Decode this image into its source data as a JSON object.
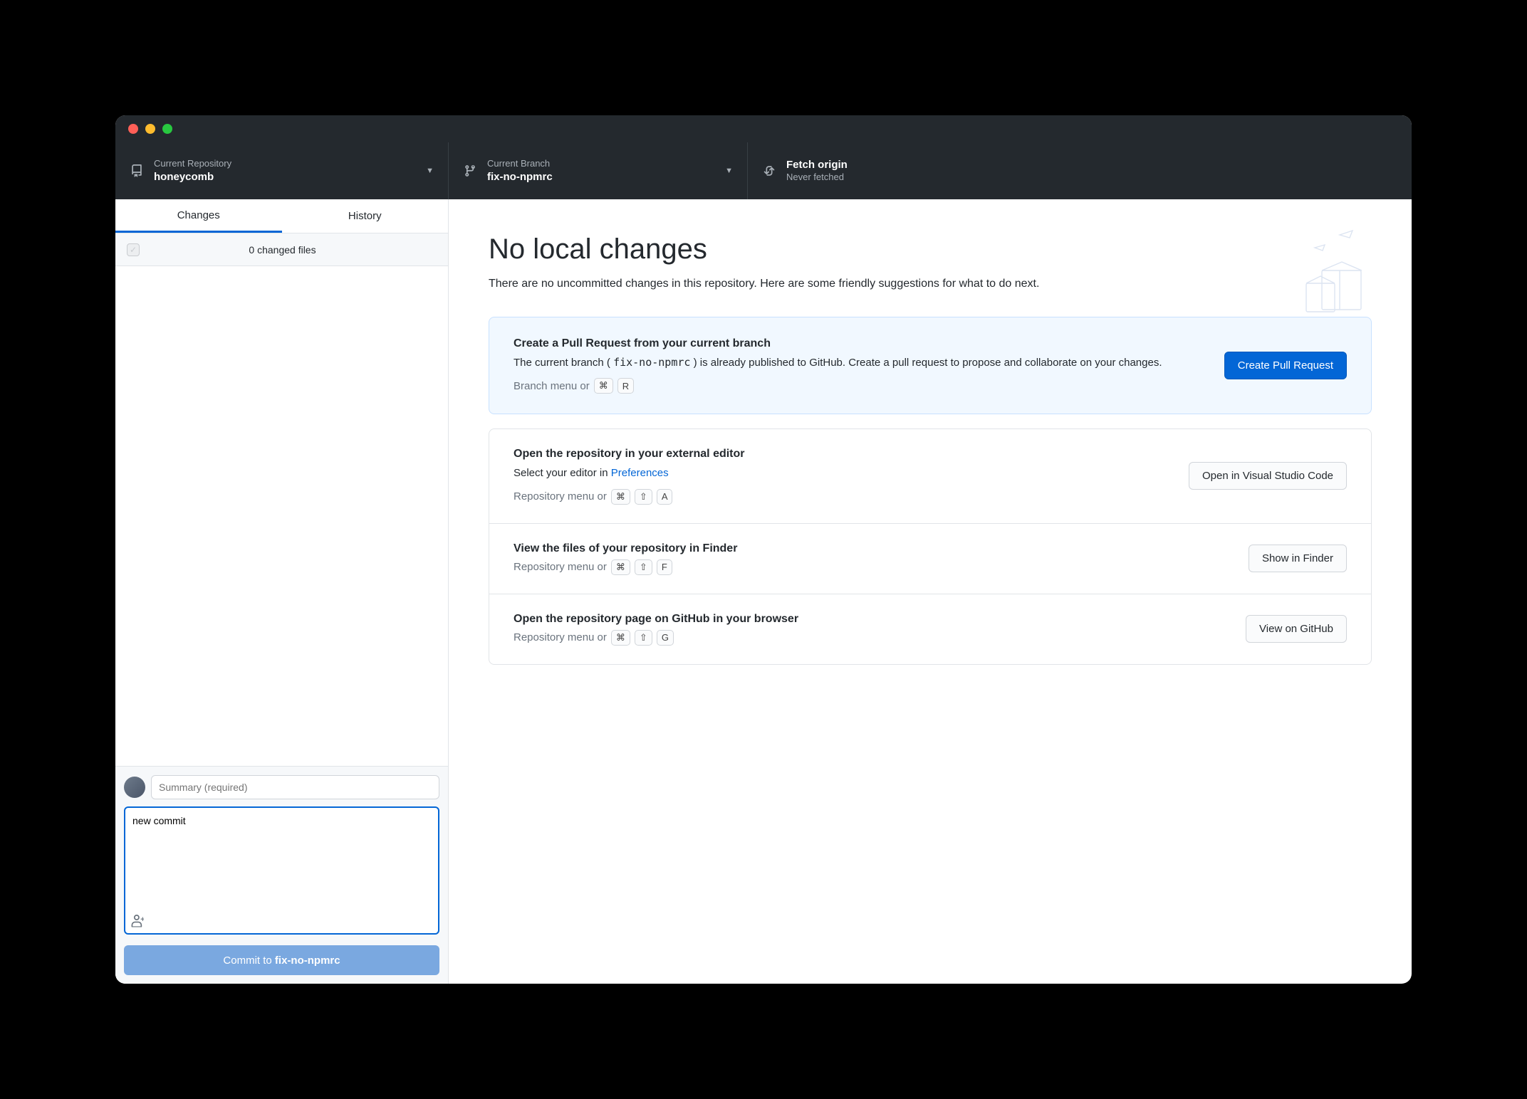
{
  "toolbar": {
    "repo": {
      "label": "Current Repository",
      "value": "honeycomb"
    },
    "branch": {
      "label": "Current Branch",
      "value": "fix-no-npmrc"
    },
    "fetch": {
      "label": "Fetch origin",
      "value": "Never fetched"
    }
  },
  "sidebar": {
    "tabs": {
      "changes": "Changes",
      "history": "History"
    },
    "changes_header": "0 changed files",
    "summary_placeholder": "Summary (required)",
    "description_value": "new commit",
    "commit_prefix": "Commit to ",
    "commit_branch": "fix-no-npmrc"
  },
  "main": {
    "heading": "No local changes",
    "subheading": "There are no uncommitted changes in this repository. Here are some friendly suggestions for what to do next.",
    "pr": {
      "title": "Create a Pull Request from your current branch",
      "desc_pre": "The current branch ( ",
      "desc_code": "fix-no-npmrc",
      "desc_post": " ) is already published to GitHub. Create a pull request to propose and collaborate on your changes.",
      "hint_text": "Branch menu or",
      "kbd1": "⌘",
      "kbd2": "R",
      "button": "Create Pull Request"
    },
    "editor": {
      "title": "Open the repository in your external editor",
      "desc_pre": "Select your editor in ",
      "link": "Preferences",
      "hint_text": "Repository menu or",
      "kbd1": "⌘",
      "kbd2": "⇧",
      "kbd3": "A",
      "button": "Open in Visual Studio Code"
    },
    "finder": {
      "title": "View the files of your repository in Finder",
      "hint_text": "Repository menu or",
      "kbd1": "⌘",
      "kbd2": "⇧",
      "kbd3": "F",
      "button": "Show in Finder"
    },
    "github": {
      "title": "Open the repository page on GitHub in your browser",
      "hint_text": "Repository menu or",
      "kbd1": "⌘",
      "kbd2": "⇧",
      "kbd3": "G",
      "button": "View on GitHub"
    }
  }
}
